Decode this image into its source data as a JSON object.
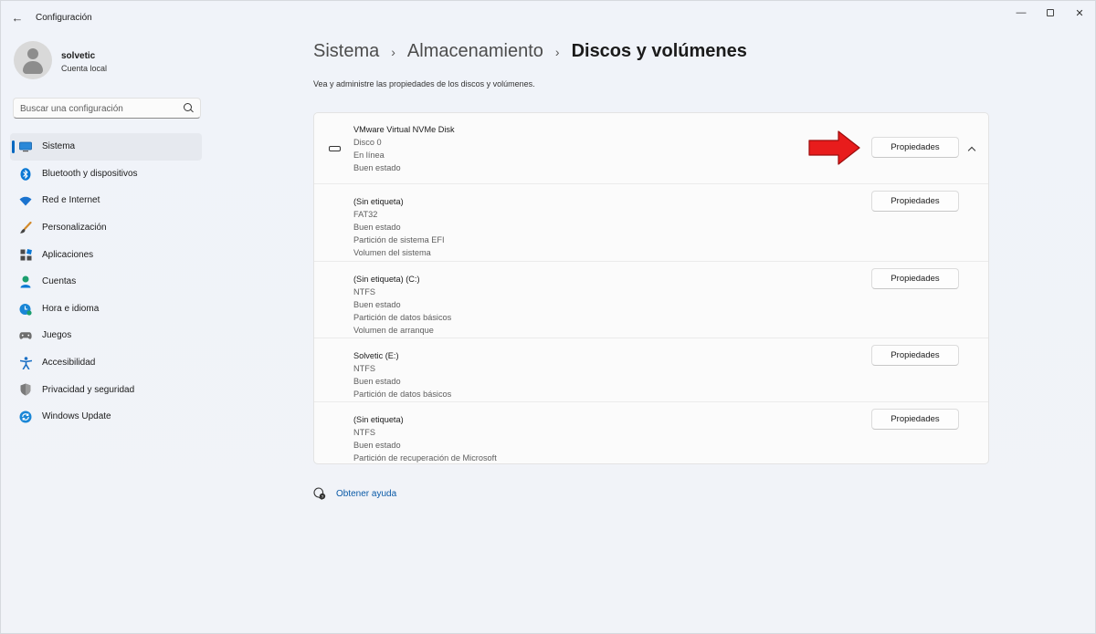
{
  "window": {
    "title": "Configuración"
  },
  "user": {
    "name": "solvetic",
    "account_type": "Cuenta local"
  },
  "search": {
    "placeholder": "Buscar una configuración"
  },
  "nav": {
    "items": [
      {
        "label": "Sistema",
        "icon": "system-icon",
        "active": true
      },
      {
        "label": "Bluetooth y dispositivos",
        "icon": "bluetooth-icon"
      },
      {
        "label": "Red e Internet",
        "icon": "wifi-icon"
      },
      {
        "label": "Personalización",
        "icon": "brush-icon"
      },
      {
        "label": "Aplicaciones",
        "icon": "apps-icon"
      },
      {
        "label": "Cuentas",
        "icon": "account-icon"
      },
      {
        "label": "Hora e idioma",
        "icon": "clock-globe-icon"
      },
      {
        "label": "Juegos",
        "icon": "gamepad-icon"
      },
      {
        "label": "Accesibilidad",
        "icon": "accessibility-icon"
      },
      {
        "label": "Privacidad y seguridad",
        "icon": "shield-icon"
      },
      {
        "label": "Windows Update",
        "icon": "update-icon"
      }
    ]
  },
  "breadcrumb": {
    "level1": "Sistema",
    "level2": "Almacenamiento",
    "current": "Discos y volúmenes"
  },
  "subtitle": "Vea y administre las propiedades de los discos y volúmenes.",
  "disk": {
    "lines": [
      "VMware Virtual NVMe Disk",
      "Disco 0",
      "En línea",
      "Buen estado"
    ],
    "button": "Propiedades"
  },
  "volumes": [
    {
      "lines": [
        "(Sin etiqueta)",
        "FAT32",
        "Buen estado",
        "Partición de sistema EFI",
        "Volumen del sistema"
      ],
      "button": "Propiedades"
    },
    {
      "lines": [
        "(Sin etiqueta) (C:)",
        "NTFS",
        "Buen estado",
        "Partición de datos básicos",
        "Volumen de arranque"
      ],
      "button": "Propiedades"
    },
    {
      "lines": [
        "Solvetic (E:)",
        "NTFS",
        "Buen estado",
        "Partición de datos básicos"
      ],
      "button": "Propiedades"
    },
    {
      "lines": [
        "(Sin etiqueta)",
        "NTFS",
        "Buen estado",
        "Partición de recuperación de Microsoft"
      ],
      "button": "Propiedades"
    }
  ],
  "help": {
    "label": "Obtener ayuda"
  },
  "colors": {
    "accent": "#0067c0",
    "arrow": "#e81c1c"
  }
}
